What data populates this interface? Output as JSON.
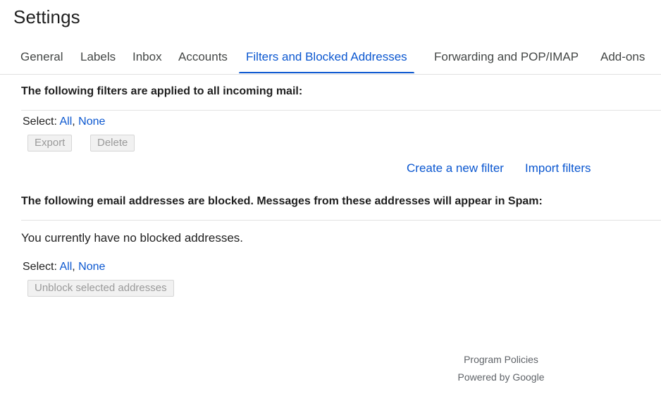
{
  "page_title": "Settings",
  "tabs": [
    {
      "label": "General",
      "active": false
    },
    {
      "label": "Labels",
      "active": false
    },
    {
      "label": "Inbox",
      "active": false
    },
    {
      "label": "Accounts",
      "active": false
    },
    {
      "label": "Filters and Blocked Addresses",
      "active": true
    },
    {
      "label": "Forwarding and POP/IMAP",
      "active": false
    },
    {
      "label": "Add-ons",
      "active": false
    }
  ],
  "filters_section": {
    "heading": "The following filters are applied to all incoming mail:",
    "select_label": "Select: ",
    "select_all": "All",
    "separator": ", ",
    "select_none": "None",
    "export_label": "Export",
    "delete_label": "Delete",
    "create_filter_link": "Create a new filter",
    "import_filters_link": "Import filters"
  },
  "blocked_section": {
    "heading": "The following email addresses are blocked. Messages from these addresses will appear in Spam:",
    "empty_message": "You currently have no blocked addresses.",
    "select_label": "Select: ",
    "select_all": "All",
    "separator": ", ",
    "select_none": "None",
    "unblock_label": "Unblock selected addresses"
  },
  "footer": {
    "program_policies": "Program Policies",
    "powered_by": "Powered by Google"
  },
  "colors": {
    "accent": "#0b57d0",
    "text": "#1f1f1f",
    "muted": "#5f6368",
    "disabled_text": "#9a9a9a",
    "divider": "#e3e3e3"
  }
}
